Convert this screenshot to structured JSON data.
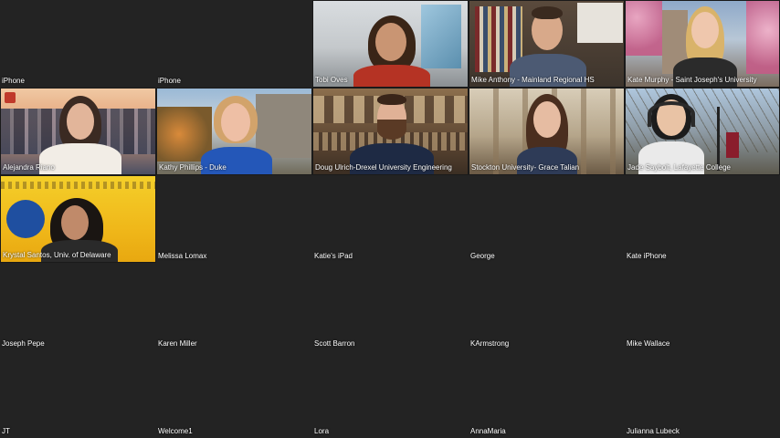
{
  "participants": [
    {
      "name": "iPhone",
      "video": false
    },
    {
      "name": "iPhone",
      "video": false
    },
    {
      "name": "Tobi Oves",
      "video": true
    },
    {
      "name": "Mike Anthony - Mainland Regional HS",
      "video": true
    },
    {
      "name": "Kate Murphy - Saint Joseph's University",
      "video": true
    },
    {
      "name": "Alejandra Riano",
      "video": true
    },
    {
      "name": "Kathy Phillips - Duke",
      "video": true
    },
    {
      "name": "Doug Ulrich-Drexel University Engineering",
      "video": true
    },
    {
      "name": "Stockton University- Grace Talian",
      "video": true
    },
    {
      "name": "Jade Saybolt, Lafayette College",
      "video": true
    },
    {
      "name": "Krystal Santos, Univ. of Delaware",
      "video": true
    },
    {
      "name": "Melissa Lomax",
      "video": false
    },
    {
      "name": "Katie's iPad",
      "video": false
    },
    {
      "name": "George",
      "video": false
    },
    {
      "name": "Kate iPhone",
      "video": false
    },
    {
      "name": "Joseph Pepe",
      "video": false
    },
    {
      "name": "Karen Miller",
      "video": false
    },
    {
      "name": "Scott Barron",
      "video": false
    },
    {
      "name": "KArmstrong",
      "video": false
    },
    {
      "name": "Mike Wallace",
      "video": false
    },
    {
      "name": "JT",
      "video": false
    },
    {
      "name": "Welcome1",
      "video": false
    },
    {
      "name": "Lora",
      "video": false
    },
    {
      "name": "AnnaMaria",
      "video": false
    },
    {
      "name": "Julianna Lubeck",
      "video": false
    }
  ],
  "colors": {
    "background": "#1a1a1a",
    "tile": "#232323",
    "label": "#ffffff"
  }
}
